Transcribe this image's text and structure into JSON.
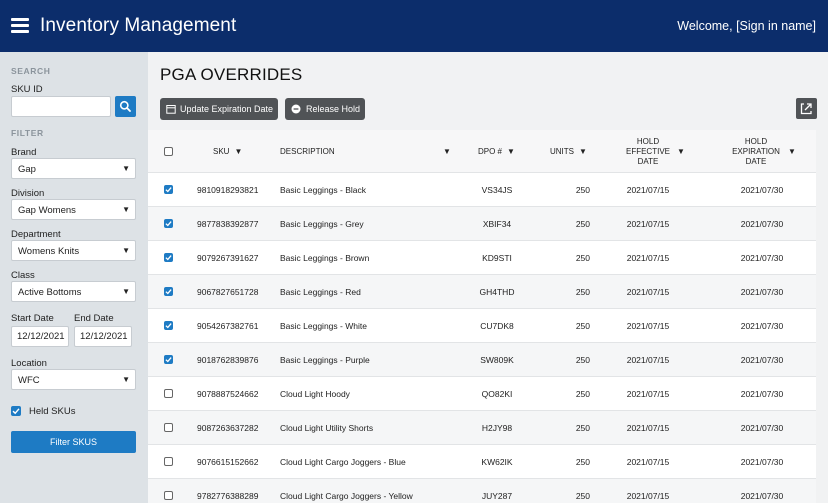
{
  "header": {
    "app_title": "Inventory Management",
    "welcome": "Welcome, [Sign in name]"
  },
  "sidebar": {
    "search_section": "SEARCH",
    "sku_id_label": "SKU ID",
    "sku_id_value": "",
    "filter_section": "FILTER",
    "brand_label": "Brand",
    "brand_value": "Gap",
    "division_label": "Division",
    "division_value": "Gap Womens",
    "department_label": "Department",
    "department_value": "Womens Knits",
    "class_label": "Class",
    "class_value": "Active Bottoms",
    "start_date_label": "Start Date",
    "start_date_value": "12/12/2021",
    "end_date_label": "End Date",
    "end_date_value": "12/12/2021",
    "location_label": "Location",
    "location_value": "WFC",
    "held_skus_label": "Held SKUs",
    "held_skus_checked": true,
    "filter_button": "Filter SKUS"
  },
  "main": {
    "title": "PGA OVERRIDES",
    "update_button": "Update Expiration Date",
    "release_button": "Release Hold"
  },
  "table": {
    "headers": {
      "sku": "SKU",
      "description": "DESCRIPTION",
      "dpo": "DPO #",
      "units": "UNITS",
      "hold_eff": [
        "HOLD",
        "EFFECTIVE",
        "DATE"
      ],
      "hold_exp": [
        "HOLD",
        "EXPIRATION",
        "DATE"
      ]
    },
    "rows": [
      {
        "checked": true,
        "sku": "9810918293821",
        "description": "Basic Leggings - Black",
        "dpo": "VS34JS",
        "units": "250",
        "eff": "2021/07/15",
        "exp": "2021/07/30"
      },
      {
        "checked": true,
        "sku": "9877838392877",
        "description": "Basic Leggings - Grey",
        "dpo": "XBIF34",
        "units": "250",
        "eff": "2021/07/15",
        "exp": "2021/07/30"
      },
      {
        "checked": true,
        "sku": "9079267391627",
        "description": "Basic Leggings - Brown",
        "dpo": "KD9STI",
        "units": "250",
        "eff": "2021/07/15",
        "exp": "2021/07/30"
      },
      {
        "checked": true,
        "sku": "9067827651728",
        "description": "Basic Leggings - Red",
        "dpo": "GH4THD",
        "units": "250",
        "eff": "2021/07/15",
        "exp": "2021/07/30"
      },
      {
        "checked": true,
        "sku": "9054267382761",
        "description": "Basic Leggings - White",
        "dpo": "CU7DK8",
        "units": "250",
        "eff": "2021/07/15",
        "exp": "2021/07/30"
      },
      {
        "checked": true,
        "sku": "9018762839876",
        "description": "Basic Leggings - Purple",
        "dpo": "SW809K",
        "units": "250",
        "eff": "2021/07/15",
        "exp": "2021/07/30"
      },
      {
        "checked": false,
        "sku": "9078887524662",
        "description": "Cloud Light Hoody",
        "dpo": "QO82KI",
        "units": "250",
        "eff": "2021/07/15",
        "exp": "2021/07/30"
      },
      {
        "checked": false,
        "sku": "9087263637282",
        "description": "Cloud Light Utility Shorts",
        "dpo": "H2JY98",
        "units": "250",
        "eff": "2021/07/15",
        "exp": "2021/07/30"
      },
      {
        "checked": false,
        "sku": "9076615152662",
        "description": "Cloud Light Cargo Joggers - Blue",
        "dpo": "KW62IK",
        "units": "250",
        "eff": "2021/07/15",
        "exp": "2021/07/30"
      },
      {
        "checked": false,
        "sku": "9782776388289",
        "description": "Cloud Light Cargo Joggers - Yellow",
        "dpo": "JUY287",
        "units": "250",
        "eff": "2021/07/15",
        "exp": "2021/07/30"
      }
    ]
  },
  "colors": {
    "header_bg": "#0c2d6b",
    "accent": "#1e7bc4",
    "sidebar_bg": "#dde2e6",
    "button_dark": "#505356"
  },
  "icons": {
    "menu": "hamburger-icon",
    "search": "search-icon",
    "calendar": "calendar-icon",
    "release": "minus-circle-icon",
    "export": "export-icon",
    "sort": "sort-down-icon",
    "check": "check-icon"
  }
}
